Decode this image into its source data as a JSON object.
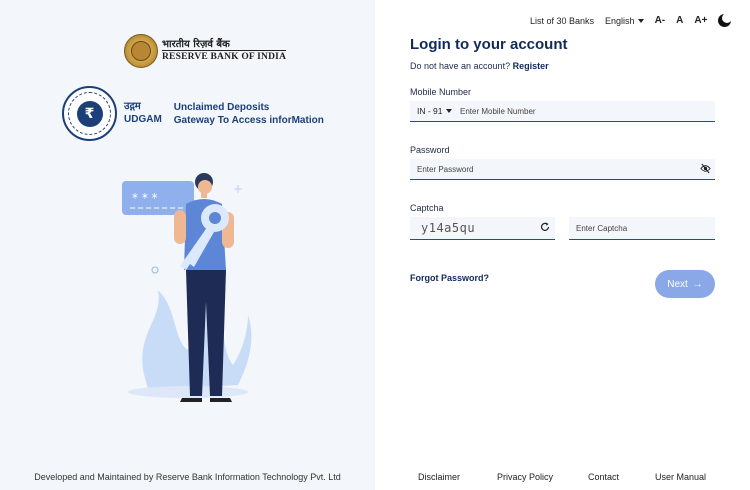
{
  "rbi": {
    "hindi": "भारतीय रिज़र्व बैंक",
    "english": "RESERVE BANK OF INDIA"
  },
  "udgam": {
    "hindi": "उद्गम",
    "name": "UDGAM",
    "tagline_1": "Unclaimed Deposits",
    "tagline_2": "Gateway To Access inforMation",
    "badge_symbol": "₹"
  },
  "illustration": {
    "password_mask": "* * *"
  },
  "left_footer": "Developed and Maintained by Reserve Bank Information Technology Pvt. Ltd",
  "topbar": {
    "banks_link": "List of 30 Banks",
    "language": "English",
    "font_small": "A-",
    "font_normal": "A",
    "font_large": "A+"
  },
  "login": {
    "title": "Login to your account",
    "no_account": "Do not have an account?",
    "register": "Register",
    "mobile_label": "Mobile Number",
    "country_code": "IN - 91",
    "mobile_placeholder": "Enter Mobile Number",
    "password_label": "Password",
    "password_placeholder": "Enter Password",
    "captcha_label": "Captcha",
    "captcha_value": "y14a5qu",
    "captcha_placeholder": "Enter Captcha",
    "forgot": "Forgot Password?",
    "next": "Next"
  },
  "footer_links": [
    "Disclaimer",
    "Privacy Policy",
    "Contact",
    "User Manual"
  ],
  "colors": {
    "primary": "#102a5c",
    "button": "#8aa8e8",
    "panel_bg": "#f3f6fb"
  }
}
